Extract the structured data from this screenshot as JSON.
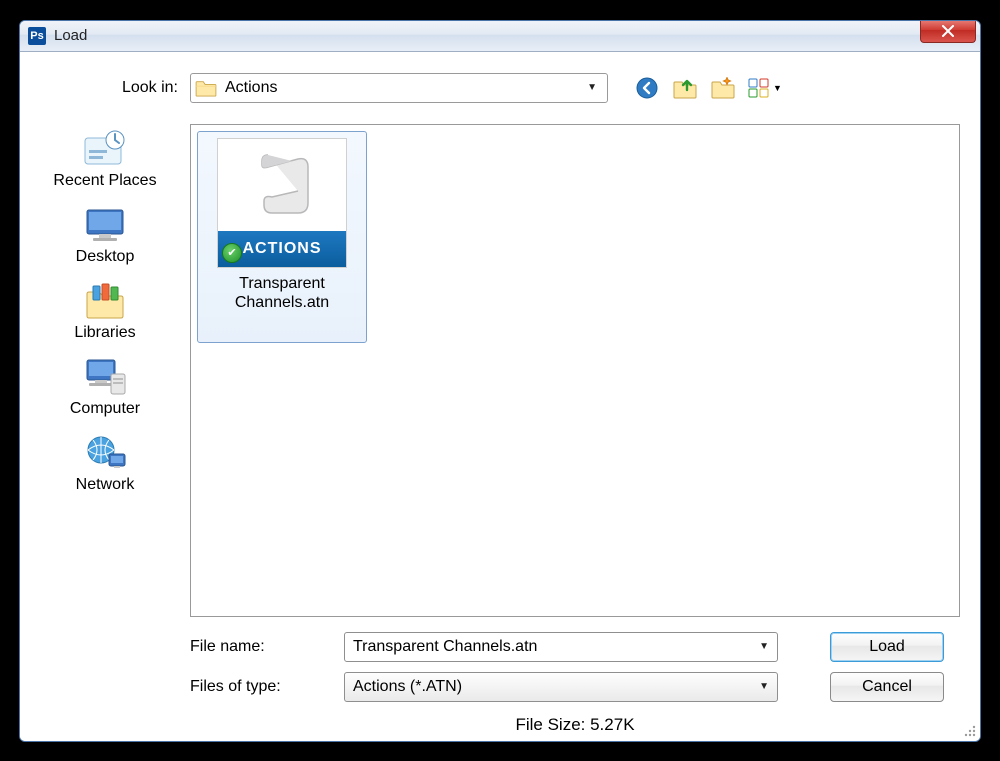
{
  "window": {
    "title": "Load",
    "icon_label": "Ps"
  },
  "lookin": {
    "label": "Look in:",
    "value": "Actions"
  },
  "places": [
    {
      "label": "Recent Places",
      "icon": "recent"
    },
    {
      "label": "Desktop",
      "icon": "desktop"
    },
    {
      "label": "Libraries",
      "icon": "libraries"
    },
    {
      "label": "Computer",
      "icon": "computer"
    },
    {
      "label": "Network",
      "icon": "network"
    }
  ],
  "files": [
    {
      "label": "Transparent Channels.atn",
      "badge": "ACTIONS"
    }
  ],
  "filename": {
    "label": "File name:",
    "value": "Transparent Channels.atn"
  },
  "filetype": {
    "label": "Files of type:",
    "value": "Actions (*.ATN)"
  },
  "buttons": {
    "load": "Load",
    "cancel": "Cancel"
  },
  "status": "File Size: 5.27K",
  "toolbar_icons": [
    "back",
    "up",
    "new-folder",
    "view-menu"
  ]
}
